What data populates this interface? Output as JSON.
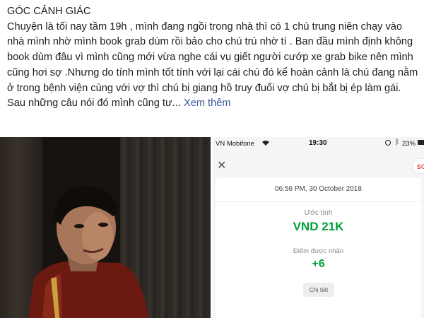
{
  "post": {
    "title": "GÓC CẢNH GIÁC",
    "body": "Chuyện là tối nay tầm 19h , mình đang ngồi trong nhà thì có 1 chú trung niên chạy vào nhà mình nhờ mình book grab dùm rồi bảo cho chú trú nhờ tí . Ban đầu mình định không book dùm đâu vì mình cũng mới vừa nghe cái vụ giết người cướp xe grab bike nên mình cũng hơi sợ .Nhưng do tính mình tốt tính với lại cái chú đó kể hoàn cảnh là chú đang nằm ở trong bệnh viện cùng với vợ thì chú bị giang hồ truy đuổi vợ chú bị bắt bị ép làm gái. Sau những câu nói đó mình cũng tư...",
    "see_more": "Xem thêm"
  },
  "phone": {
    "status": {
      "carrier": "VN Mobifone",
      "time": "19:30",
      "battery": "23%"
    },
    "support_label": "SO",
    "ride_datetime": "06:56 PM, 30 October 2018",
    "fare_label": "Ước tính",
    "fare_value": "VND 21K",
    "points_label": "Điểm được nhận",
    "points_value": "+6",
    "details_label": "Chi tiết"
  },
  "colors": {
    "accent_green": "#00a13a",
    "link_blue": "#385898"
  }
}
